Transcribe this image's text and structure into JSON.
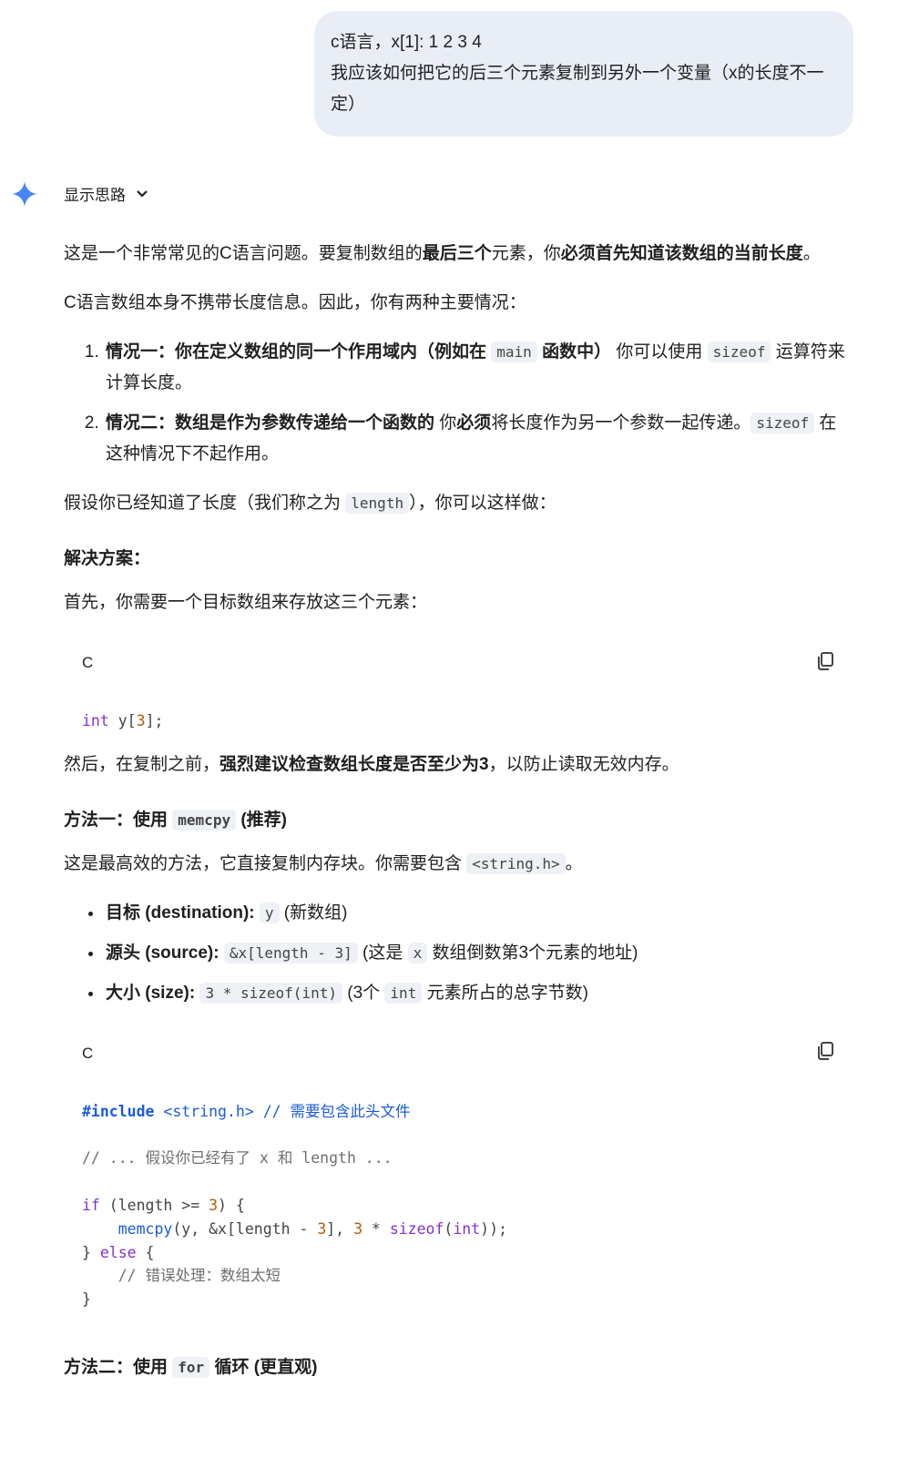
{
  "user_message": {
    "lines": [
      "c语言，x[1]: 1 2 3 4",
      "我应该如何把它的后三个元素复制到另外一个变量（x的长度不一定）"
    ]
  },
  "thoughts": {
    "label": "显示思路"
  },
  "colors": {
    "bubble": "#e9eef6",
    "code_bg": "#f0f4f9",
    "keyword": "#8430ce",
    "function": "#1a5cd8",
    "number": "#b55c0a"
  },
  "blocks": [
    {
      "type": "p",
      "runs": [
        [
          "t",
          "这是一个非常常见的C语言问题。要复制数组的"
        ],
        [
          "b",
          "最后三个"
        ],
        [
          "t",
          "元素，你"
        ],
        [
          "b",
          "必须首先知道该数组的当前长度"
        ],
        [
          "t",
          "。"
        ]
      ]
    },
    {
      "type": "p",
      "runs": [
        [
          "t",
          "C语言数组本身不携带长度信息。因此，你有两种主要情况："
        ]
      ]
    },
    {
      "type": "ol",
      "items": [
        [
          [
            "b",
            "情况一：你在定义数组的同一个作用域内（例如在 "
          ],
          [
            "c",
            "main"
          ],
          [
            "b",
            " 函数中）"
          ],
          [
            "t",
            " 你可以使用 "
          ],
          [
            "c",
            "sizeof"
          ],
          [
            "t",
            " 运算符来计算长度。"
          ]
        ],
        [
          [
            "b",
            "情况二：数组是作为参数传递给一个函数的"
          ],
          [
            "t",
            " 你"
          ],
          [
            "b",
            "必须"
          ],
          [
            "t",
            "将长度作为另一个参数一起传递。"
          ],
          [
            "c",
            "sizeof"
          ],
          [
            "t",
            " 在这种情况下不起作用。"
          ]
        ]
      ]
    },
    {
      "type": "p",
      "runs": [
        [
          "t",
          "假设你已经知道了长度（我们称之为 "
        ],
        [
          "c",
          "length"
        ],
        [
          "t",
          "），你可以这样做："
        ]
      ]
    },
    {
      "type": "h",
      "runs": [
        [
          "b",
          "解决方案："
        ]
      ]
    },
    {
      "type": "p",
      "runs": [
        [
          "t",
          "首先，你需要一个目标数组来存放这三个元素："
        ]
      ]
    },
    {
      "type": "code",
      "lang": "C",
      "lines": [
        [
          [
            "kw",
            "int"
          ],
          [
            "t",
            " y["
          ],
          [
            "num",
            "3"
          ],
          [
            "t",
            "];"
          ]
        ]
      ]
    },
    {
      "type": "p",
      "runs": [
        [
          "t",
          "然后，在复制之前，"
        ],
        [
          "b",
          "强烈建议检查数组长度是否至少为3"
        ],
        [
          "t",
          "，以防止读取无效内存。"
        ]
      ]
    },
    {
      "type": "h",
      "runs": [
        [
          "b",
          "方法一：使用 "
        ],
        [
          "c",
          "memcpy"
        ],
        [
          "b",
          " (推荐)"
        ]
      ]
    },
    {
      "type": "p",
      "runs": [
        [
          "t",
          "这是最高效的方法，它直接复制内存块。你需要包含 "
        ],
        [
          "c",
          "<string.h>"
        ],
        [
          "t",
          "。"
        ]
      ]
    },
    {
      "type": "ul",
      "items": [
        [
          [
            "b",
            "目标 (destination):"
          ],
          [
            "t",
            " "
          ],
          [
            "c",
            "y"
          ],
          [
            "t",
            " (新数组)"
          ]
        ],
        [
          [
            "b",
            "源头 (source):"
          ],
          [
            "t",
            " "
          ],
          [
            "c",
            "&x[length - 3]"
          ],
          [
            "t",
            " (这是 "
          ],
          [
            "c",
            "x"
          ],
          [
            "t",
            " 数组倒数第3个元素的地址)"
          ]
        ],
        [
          [
            "b",
            "大小 (size):"
          ],
          [
            "t",
            " "
          ],
          [
            "c",
            "3 * sizeof(int)"
          ],
          [
            "t",
            " (3个 "
          ],
          [
            "c",
            "int"
          ],
          [
            "t",
            " 元素所占的总字节数)"
          ]
        ]
      ]
    },
    {
      "type": "code",
      "lang": "C",
      "lines": [
        [
          [
            "incb",
            "#include"
          ],
          [
            "inc",
            " <string.h> // 需要包含此头文件"
          ]
        ],
        [],
        [
          [
            "cm",
            "// ... 假设你已经有了 x 和 length ..."
          ]
        ],
        [],
        [
          [
            "kw",
            "if"
          ],
          [
            "t",
            " (length >= "
          ],
          [
            "num",
            "3"
          ],
          [
            "t",
            ") {"
          ]
        ],
        [
          [
            "t",
            "    "
          ],
          [
            "fn",
            "memcpy"
          ],
          [
            "t",
            "(y, &x[length - "
          ],
          [
            "num",
            "3"
          ],
          [
            "t",
            "], "
          ],
          [
            "num",
            "3"
          ],
          [
            "t",
            " * "
          ],
          [
            "kw",
            "sizeof"
          ],
          [
            "t",
            "("
          ],
          [
            "kw",
            "int"
          ],
          [
            "t",
            "));"
          ]
        ],
        [
          [
            "t",
            "} "
          ],
          [
            "kw",
            "else"
          ],
          [
            "t",
            " {"
          ]
        ],
        [
          [
            "t",
            "    "
          ],
          [
            "cm",
            "// 错误处理：数组太短"
          ]
        ],
        [
          [
            "t",
            "}"
          ]
        ]
      ]
    },
    {
      "type": "h",
      "runs": [
        [
          "b",
          "方法二：使用 "
        ],
        [
          "c",
          "for"
        ],
        [
          "b",
          " 循环 (更直观)"
        ]
      ]
    }
  ]
}
